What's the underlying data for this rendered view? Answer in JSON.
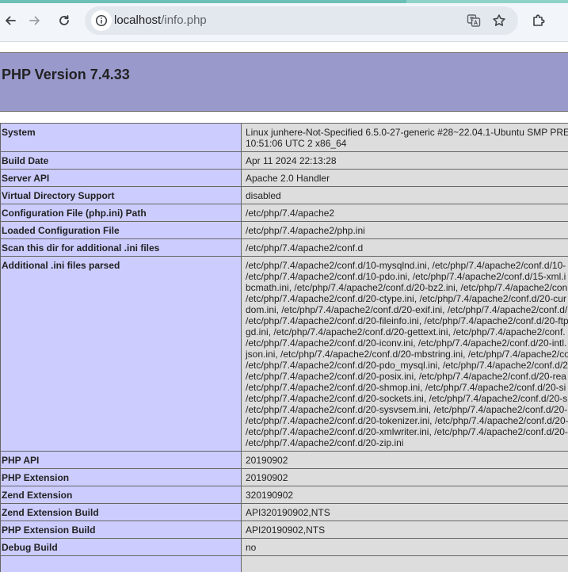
{
  "browser": {
    "url_host": "localhost",
    "url_path": "/info.php",
    "icons": [
      "back-icon",
      "forward-icon",
      "reload-icon",
      "site-info-icon",
      "translate-icon",
      "bookmark-star-icon",
      "extensions-icon"
    ]
  },
  "page": {
    "title": "PHP Version 7.4.33"
  },
  "rows": [
    {
      "key": "System",
      "lines": [
        "Linux junhere-Not-Specified 6.5.0-27-generic #28~22.04.1-Ubuntu SMP PRE",
        "10:51:06 UTC 2 x86_64"
      ]
    },
    {
      "key": "Build Date",
      "lines": [
        "Apr 11 2024 22:13:28"
      ]
    },
    {
      "key": "Server API",
      "lines": [
        "Apache 2.0 Handler"
      ]
    },
    {
      "key": "Virtual Directory Support",
      "lines": [
        "disabled"
      ]
    },
    {
      "key": "Configuration File (php.ini) Path",
      "lines": [
        "/etc/php/7.4/apache2"
      ]
    },
    {
      "key": "Loaded Configuration File",
      "lines": [
        "/etc/php/7.4/apache2/php.ini"
      ]
    },
    {
      "key": "Scan this dir for additional .ini files",
      "lines": [
        "/etc/php/7.4/apache2/conf.d"
      ]
    },
    {
      "key": "Additional .ini files parsed",
      "lines": [
        "/etc/php/7.4/apache2/conf.d/10-mysqlnd.ini, /etc/php/7.4/apache2/conf.d/10-",
        "/etc/php/7.4/apache2/conf.d/10-pdo.ini, /etc/php/7.4/apache2/conf.d/15-xml.i",
        "bcmath.ini, /etc/php/7.4/apache2/conf.d/20-bz2.ini, /etc/php/7.4/apache2/con",
        "/etc/php/7.4/apache2/conf.d/20-ctype.ini, /etc/php/7.4/apache2/conf.d/20-cur",
        "dom.ini, /etc/php/7.4/apache2/conf.d/20-exif.ini, /etc/php/7.4/apache2/conf.d/",
        "/etc/php/7.4/apache2/conf.d/20-fileinfo.ini, /etc/php/7.4/apache2/conf.d/20-ftp",
        "gd.ini, /etc/php/7.4/apache2/conf.d/20-gettext.ini, /etc/php/7.4/apache2/conf.",
        "/etc/php/7.4/apache2/conf.d/20-iconv.ini, /etc/php/7.4/apache2/conf.d/20-intl.",
        "json.ini, /etc/php/7.4/apache2/conf.d/20-mbstring.ini, /etc/php/7.4/apache2/co",
        "/etc/php/7.4/apache2/conf.d/20-pdo_mysql.ini, /etc/php/7.4/apache2/conf.d/2",
        "/etc/php/7.4/apache2/conf.d/20-posix.ini, /etc/php/7.4/apache2/conf.d/20-rea",
        "/etc/php/7.4/apache2/conf.d/20-shmop.ini, /etc/php/7.4/apache2/conf.d/20-si",
        "/etc/php/7.4/apache2/conf.d/20-sockets.ini, /etc/php/7.4/apache2/conf.d/20-s",
        "/etc/php/7.4/apache2/conf.d/20-sysvsem.ini, /etc/php/7.4/apache2/conf.d/20-",
        "/etc/php/7.4/apache2/conf.d/20-tokenizer.ini, /etc/php/7.4/apache2/conf.d/20-",
        "/etc/php/7.4/apache2/conf.d/20-xmlwriter.ini, /etc/php/7.4/apache2/conf.d/20-",
        "/etc/php/7.4/apache2/conf.d/20-zip.ini"
      ]
    },
    {
      "key": "PHP API",
      "lines": [
        "20190902"
      ]
    },
    {
      "key": "PHP Extension",
      "lines": [
        "20190902"
      ]
    },
    {
      "key": "Zend Extension",
      "lines": [
        "320190902"
      ]
    },
    {
      "key": "Zend Extension Build",
      "lines": [
        "API320190902,NTS"
      ]
    },
    {
      "key": "PHP Extension Build",
      "lines": [
        "API20190902,NTS"
      ]
    },
    {
      "key": "Debug Build",
      "lines": [
        "no"
      ]
    },
    {
      "key": "",
      "lines": [
        ""
      ]
    }
  ],
  "colors": {
    "header_bg": "#9999cc",
    "key_bg": "#ccccff",
    "value_bg": "#dddddd",
    "border": "#666666"
  }
}
